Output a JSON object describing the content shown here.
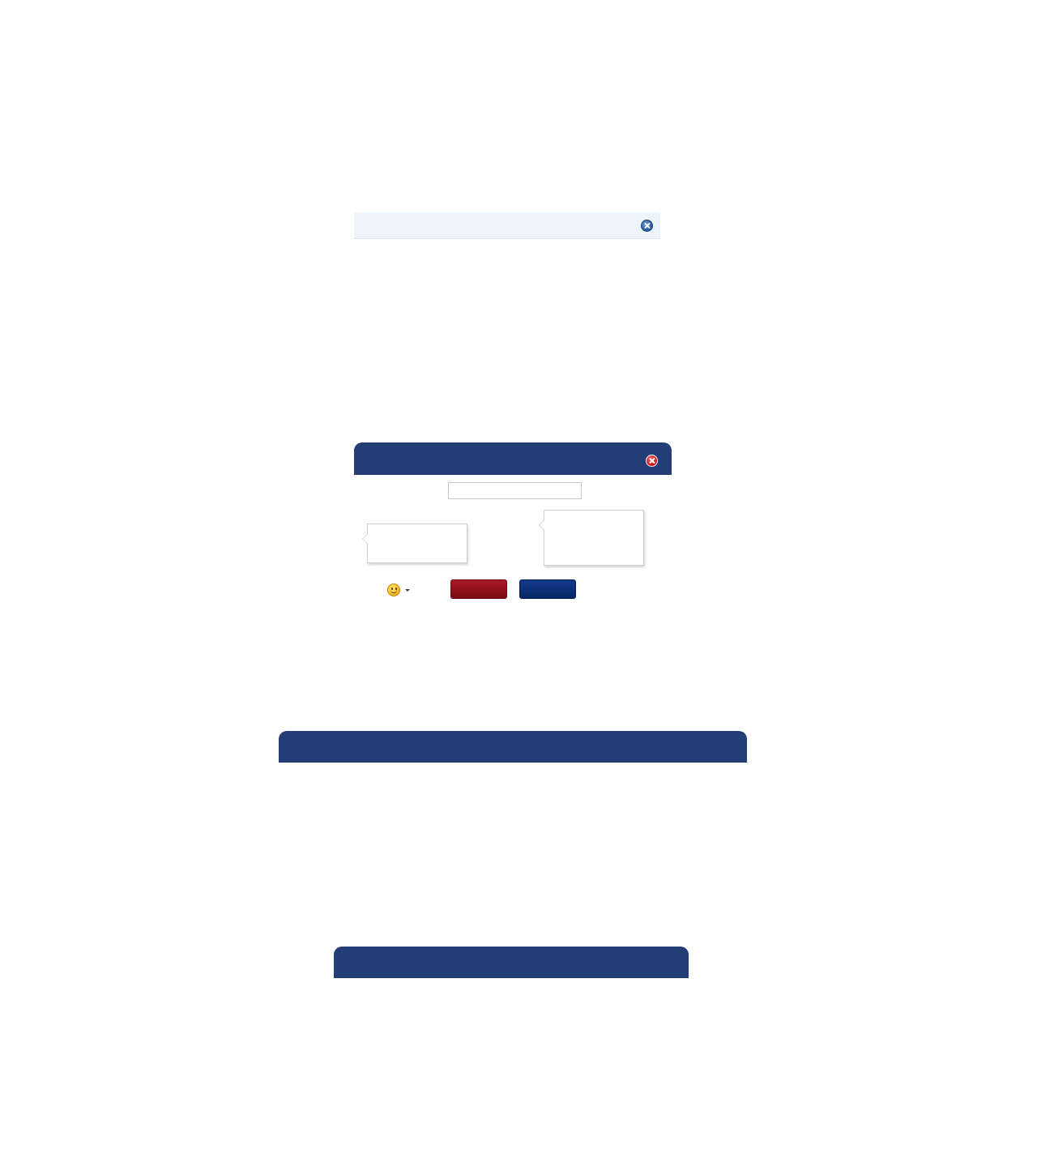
{
  "notice_bar": {
    "text": "",
    "close_icon": "close-circle-blue-icon"
  },
  "dialog": {
    "title": "",
    "close_icon": "close-circle-red-icon",
    "input": {
      "value": "",
      "placeholder": ""
    },
    "tooltip_left": {
      "text": ""
    },
    "tooltip_right": {
      "text": ""
    },
    "emoji_icon": "smiley-icon",
    "dropdown_icon": "caret-down-icon",
    "red_button_label": "",
    "blue_button_label": ""
  },
  "panel_wide": {
    "title": ""
  },
  "panel_mid": {
    "title": ""
  },
  "colors": {
    "header_navy": "#233d77",
    "notice_bg": "#edf4fc",
    "button_red": "#8f0f1c",
    "button_blue": "#0b2d74",
    "close_red": "#cc1a1a",
    "close_blue": "#2d5fa8"
  }
}
